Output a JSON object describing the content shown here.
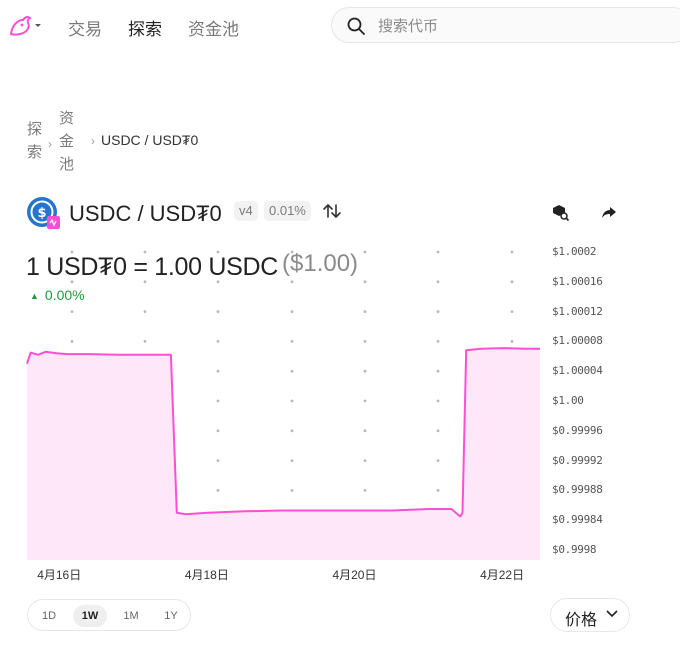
{
  "nav": {
    "items": [
      "交易",
      "探索",
      "资金池"
    ],
    "active": 1
  },
  "search": {
    "placeholder": "搜索代币"
  },
  "breadcrumb": {
    "items": [
      "探索",
      "资金池"
    ],
    "current": "USDC / USD₮0"
  },
  "pool": {
    "title": "USDC / USD₮0",
    "version": "v4",
    "fee": "0.01%"
  },
  "price": {
    "main": "1 USD₮0 = 1.00 USDC",
    "usd": "($1.00)",
    "change": "0.00%"
  },
  "ranges": {
    "items": [
      "1D",
      "1W",
      "1M",
      "1Y"
    ],
    "active": 1
  },
  "metric": {
    "label": "价格"
  },
  "colors": {
    "accent": "#fc4fd4",
    "fill": "#fde7f8",
    "positive": "#1f9d3a"
  },
  "chart_data": {
    "type": "area",
    "yticks": [
      "$1.0002",
      "$1.00016",
      "$1.00012",
      "$1.00008",
      "$1.00004",
      "$1.00",
      "$0.99996",
      "$0.99992",
      "$0.99988",
      "$0.99984",
      "$0.9998"
    ],
    "ylim": [
      0.9998,
      1.0002
    ],
    "xticks": [
      "4月16日",
      "4月18日",
      "4月20日",
      "4月22日"
    ],
    "xtick_days": [
      16,
      18,
      20,
      22
    ],
    "xlim": [
      15.55,
      22.5
    ],
    "points": [
      [
        15.55,
        1.00005
      ],
      [
        15.6,
        1.000065
      ],
      [
        15.7,
        1.000062
      ],
      [
        15.8,
        1.000066
      ],
      [
        15.95,
        1.000064
      ],
      [
        16.1,
        1.000063
      ],
      [
        16.4,
        1.000063
      ],
      [
        16.8,
        1.000062
      ],
      [
        17.3,
        1.000062
      ],
      [
        17.5,
        1.000062
      ],
      [
        17.58,
        0.99985
      ],
      [
        17.7,
        0.999848
      ],
      [
        18.0,
        0.99985
      ],
      [
        18.5,
        0.999852
      ],
      [
        19.0,
        0.999853
      ],
      [
        19.5,
        0.999853
      ],
      [
        20.0,
        0.999853
      ],
      [
        20.5,
        0.999853
      ],
      [
        21.0,
        0.999855
      ],
      [
        21.3,
        0.999855
      ],
      [
        21.42,
        0.999845
      ],
      [
        21.45,
        0.99985
      ],
      [
        21.5,
        1.000068
      ],
      [
        21.7,
        1.00007
      ],
      [
        22.0,
        1.000071
      ],
      [
        22.3,
        1.00007
      ],
      [
        22.5,
        1.00007
      ]
    ],
    "grid": "dotted"
  }
}
